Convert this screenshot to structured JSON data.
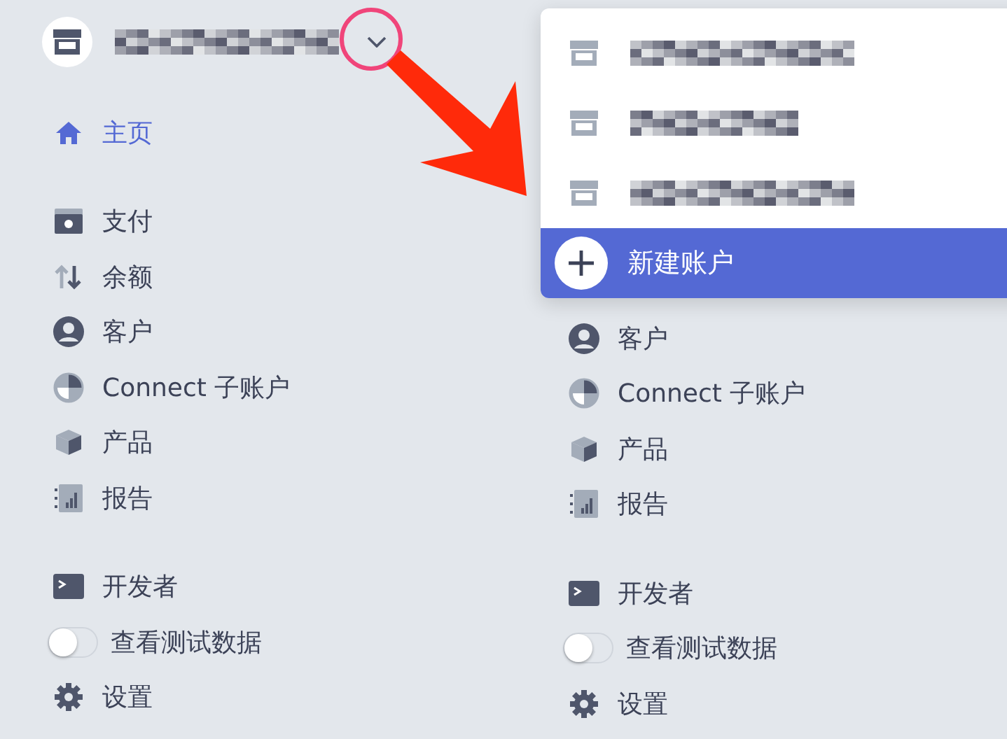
{
  "left_sidebar": {
    "account": {
      "menu_open": false
    },
    "sections": [
      [
        {
          "label": "主页",
          "kind": "home",
          "selected": true
        }
      ],
      [
        {
          "label": "支付",
          "kind": "payments",
          "selected": false
        },
        {
          "label": "余额",
          "kind": "balance",
          "selected": false
        },
        {
          "label": "客户",
          "kind": "customers",
          "selected": false
        },
        {
          "label": "Connect 子账户",
          "kind": "connect",
          "selected": false
        },
        {
          "label": "产品",
          "kind": "products",
          "selected": false
        },
        {
          "label": "报告",
          "kind": "reports",
          "selected": false
        }
      ],
      [
        {
          "label": "开发者",
          "kind": "developers",
          "selected": false
        },
        {
          "label": "查看测试数据",
          "kind": "toggle",
          "on": false
        },
        {
          "label": "设置",
          "kind": "settings",
          "selected": false
        }
      ]
    ]
  },
  "right_sidebar": {
    "sections": [
      [
        {
          "label": "客户",
          "kind": "customers",
          "selected": false
        },
        {
          "label": "Connect 子账户",
          "kind": "connect",
          "selected": false
        },
        {
          "label": "产品",
          "kind": "products",
          "selected": false
        },
        {
          "label": "报告",
          "kind": "reports",
          "selected": false
        }
      ],
      [
        {
          "label": "开发者",
          "kind": "developers",
          "selected": false
        },
        {
          "label": "查看测试数据",
          "kind": "toggle",
          "on": false
        },
        {
          "label": "设置",
          "kind": "settings",
          "selected": false
        }
      ]
    ]
  },
  "account_menu": {
    "accounts": [
      {
        "kind": "account"
      },
      {
        "kind": "account"
      },
      {
        "kind": "account"
      }
    ],
    "new_account": {
      "label": "新建账户",
      "highlighted": true
    }
  }
}
